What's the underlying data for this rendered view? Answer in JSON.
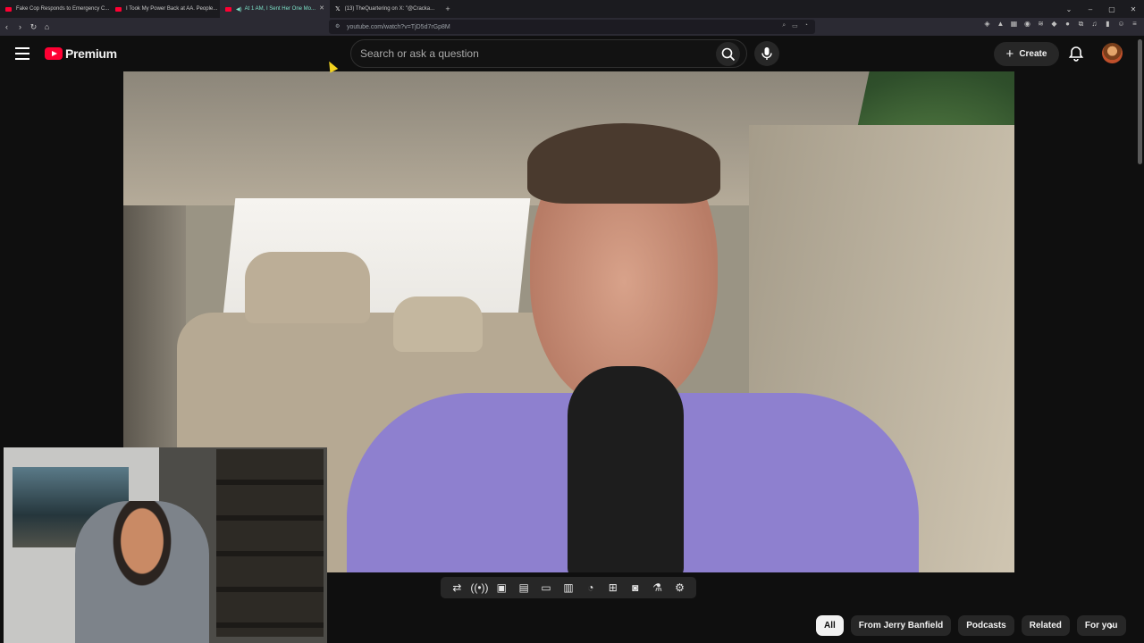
{
  "browser": {
    "tabs": [
      {
        "title": "Fake Cop Responds to Emergency C..."
      },
      {
        "title": "I Took My Power Back at AA. People..."
      },
      {
        "title": "At 1 AM, I Sent Her One Mo...",
        "active": true,
        "audio": true
      },
      {
        "title": "(13) TheQuartering on X: \"@Cracka..."
      }
    ],
    "new_tab": "+",
    "url": "youtube.com/watch?v=TjD5d7rGp8M",
    "window_controls": [
      "⌄",
      "–",
      "▢",
      "✕"
    ]
  },
  "youtube": {
    "logo_text": "Premium",
    "search_placeholder": "Search or ask a question",
    "create_label": "Create"
  },
  "player": {
    "controls": [
      "loop-icon",
      "live-icon",
      "screen-icon",
      "chapters-icon",
      "theater-icon",
      "miniplayer-icon",
      "speed-icon",
      "add-icon",
      "screenshot-icon",
      "flask-icon",
      "settings-icon"
    ]
  },
  "chips": [
    {
      "label": "All",
      "selected": true
    },
    {
      "label": "From Jerry Banfield"
    },
    {
      "label": "Podcasts"
    },
    {
      "label": "Related"
    },
    {
      "label": "For you"
    }
  ],
  "colors": {
    "background": "#0f0f0f",
    "brand_red": "#ff0033",
    "chip_bg": "#272727",
    "accent_tab": "#7de3c9"
  }
}
